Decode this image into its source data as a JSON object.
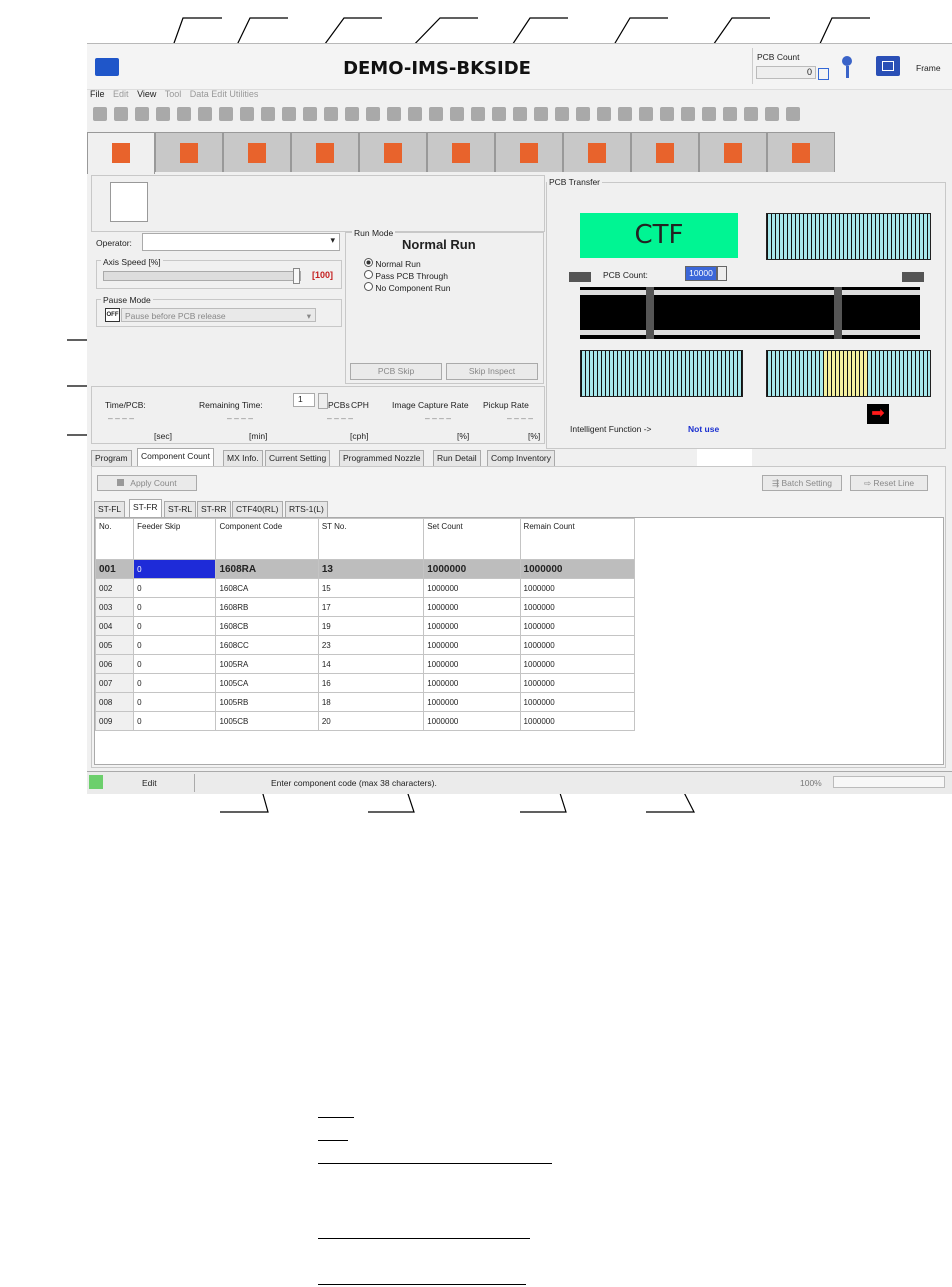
{
  "window": {
    "title": "DEMO-IMS-BKSIDE",
    "pcb_count_label": "PCB Count",
    "pcb_count_value": "0",
    "frame_label": "Frame"
  },
  "menu": [
    "File",
    "Edit",
    "View",
    "Tool",
    "Data Edit Utilities"
  ],
  "operation": {
    "operator_label": "Operator:",
    "operator_value": "",
    "axis_speed_label": "Axis Speed [%]",
    "axis_speed_value": "[100]",
    "axis_speed_percent": 100,
    "pause_mode_label": "Pause Mode",
    "pause_mode_toggle": "OFF",
    "pause_mode_value": "Pause before PCB release"
  },
  "run_mode": {
    "label": "Run Mode",
    "current": "Normal Run",
    "options": [
      "Normal Run",
      "Pass PCB Through",
      "No Component Run"
    ],
    "pcb_skip": "PCB Skip",
    "skip_inspect": "Skip Inspect"
  },
  "stats": {
    "time_pcb": "Time/PCB:",
    "remaining_time": "Remaining Time:",
    "pcbs_value": "1",
    "pcbs": "PCBs",
    "cph": "CPH",
    "image_capture_rate": "Image Capture Rate",
    "pickup_rate": "Pickup Rate",
    "dashes": "– – – –",
    "units": [
      "[sec]",
      "[min]",
      "[cph]",
      "[%]",
      "[%]"
    ]
  },
  "pcb_transfer": {
    "label": "PCB Transfer",
    "ctf": "CTF",
    "pcb_count_label": "PCB Count:",
    "pcb_count_value": "10000",
    "intelligent_label": "Intelligent Function ->",
    "intelligent_value": "Not use",
    "colors": {
      "ctf": "#00f593",
      "feeder": "#a8e8ec",
      "highlight": "#f4f0a0",
      "arrow": "#ff1a1a"
    }
  },
  "lower_tabs": [
    "Program",
    "Component Count",
    "MX Info.",
    "Current Setting",
    "Programmed Nozzle",
    "Run Detail",
    "Comp Inventory"
  ],
  "apply_count": "Apply Count",
  "batch_setting": "Batch Setting",
  "reset_line": "Reset Line",
  "station_tabs": [
    "ST-FL",
    "ST-FR",
    "ST-RL",
    "ST-RR",
    "CTF40(RL)",
    "RTS-1(L)"
  ],
  "table": {
    "columns": [
      "No.",
      "Feeder Skip",
      "Component Code",
      "ST No.",
      "Set Count",
      "Remain Count"
    ],
    "rows": [
      [
        "001",
        "0",
        "1608RA",
        "13",
        "1000000",
        "1000000"
      ],
      [
        "002",
        "0",
        "1608CA",
        "15",
        "1000000",
        "1000000"
      ],
      [
        "003",
        "0",
        "1608RB",
        "17",
        "1000000",
        "1000000"
      ],
      [
        "004",
        "0",
        "1608CB",
        "19",
        "1000000",
        "1000000"
      ],
      [
        "005",
        "0",
        "1608CC",
        "23",
        "1000000",
        "1000000"
      ],
      [
        "006",
        "0",
        "1005RA",
        "14",
        "1000000",
        "1000000"
      ],
      [
        "007",
        "0",
        "1005CA",
        "16",
        "1000000",
        "1000000"
      ],
      [
        "008",
        "0",
        "1005RB",
        "18",
        "1000000",
        "1000000"
      ],
      [
        "009",
        "0",
        "1005CB",
        "20",
        "1000000",
        "1000000"
      ]
    ]
  },
  "status_bar": {
    "mode": "Edit",
    "message": "Enter component code (max 38 characters).",
    "zoom": "100%"
  }
}
